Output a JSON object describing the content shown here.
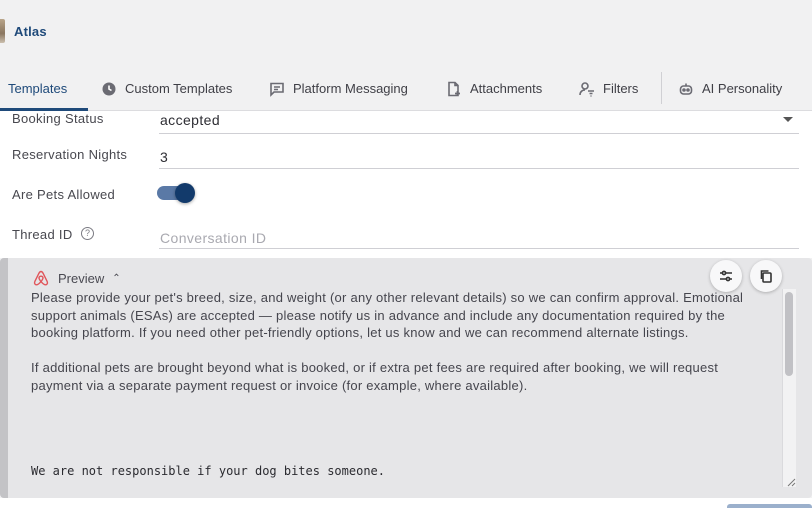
{
  "app": {
    "name": "Atlas"
  },
  "tabs": [
    {
      "label": "Templates",
      "icon": "none",
      "active": true
    },
    {
      "label": "Custom Templates",
      "icon": "clock-icon"
    },
    {
      "label": "Platform Messaging",
      "icon": "chat-icon"
    },
    {
      "label": "Attachments",
      "icon": "file-plus-icon"
    },
    {
      "label": "Filters",
      "icon": "user-filter-icon"
    },
    {
      "label": "AI Personality",
      "icon": "robot-icon"
    }
  ],
  "form": {
    "booking_status": {
      "label": "Booking Status",
      "value": "accepted"
    },
    "reservation_nights": {
      "label": "Reservation Nights",
      "value": "3"
    },
    "pets_allowed": {
      "label": "Are Pets Allowed",
      "value": true
    },
    "thread_id": {
      "label": "Thread ID",
      "placeholder": "Conversation ID",
      "help": "?"
    }
  },
  "preview": {
    "title": "Preview",
    "platform_icon": "airbnb-icon",
    "paragraphs": [
      "Please provide your pet's breed, size, and weight (or any other relevant details) so we can confirm approval. Emotional support animals (ESAs) are accepted — please notify us in advance and include any documentation required by the booking platform. If you need other pet-friendly options, let us know and we can recommend alternate listings.",
      "If additional pets are brought beyond what is booked, or if extra pet fees are required after booking, we will request payment via a separate payment request or invoice (for example, where available)."
    ],
    "mono_line": "We are not responsible if your dog bites someone."
  },
  "colors": {
    "accent": "#1f4a7a",
    "toggle_on": "#123a6b",
    "airbnb": "#e0565b"
  }
}
